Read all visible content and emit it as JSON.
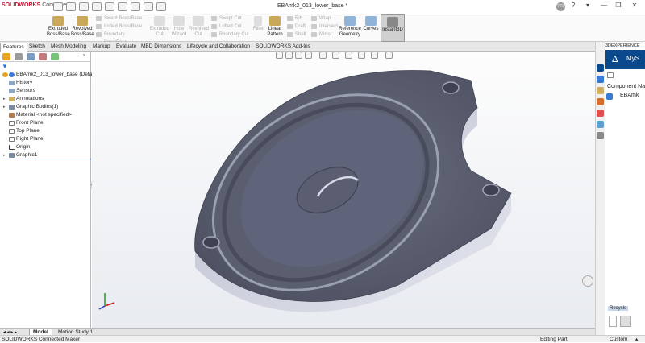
{
  "title_bar": {
    "brand": "SOLIDWORKS",
    "brand_suffix": "Connected",
    "document_title": "EBAmk2_013_lower_base *",
    "user_initials": "FR"
  },
  "ribbon": {
    "extruded_boss": "Extruded Boss/Base",
    "revolved_boss": "Revolved Boss/Base",
    "swept_boss": "Swept Boss/Base",
    "lofted_boss": "Lofted Boss/Base",
    "boundary_boss": "Boundary Boss/Base",
    "extruded_cut": "Extruded Cut",
    "hole_wizard": "Hole Wizard",
    "revolved_cut": "Revolved Cut",
    "swept_cut": "Swept Cut",
    "lofted_cut": "Lofted Cut",
    "boundary_cut": "Boundary Cut",
    "fillet": "Fillet",
    "linear_pattern": "Linear Pattern",
    "rib": "Rib",
    "draft": "Draft",
    "shell": "Shell",
    "wrap": "Wrap",
    "intersect": "Intersect",
    "mirror": "Mirror",
    "reference_geometry": "Reference Geometry",
    "curves": "Curves",
    "instant3d": "Instant3D"
  },
  "command_tabs": [
    "Features",
    "Sketch",
    "Mesh Modeling",
    "Markup",
    "Evaluate",
    "MBD Dimensions",
    "Lifecycle and Collaboration",
    "SOLIDWORKS Add-Ins"
  ],
  "feature_tree": {
    "root": "EBAmk2_013_lower_base (Default",
    "items": [
      "History",
      "Sensors",
      "Annotations",
      "Graphic Bodies(1)",
      "Material <not specified>",
      "Front Plane",
      "Top Plane",
      "Right Plane",
      "Origin",
      "Graphic1"
    ]
  },
  "task_pane": {
    "header": "3DEXPERIENCE",
    "brand": "MyS",
    "component_label": "Component Nam",
    "component_item": "EBAmk",
    "recycle": "Recycle"
  },
  "bottom_tabs": [
    "Model",
    "Motion Study 1"
  ],
  "status": {
    "left": "SOLIDWORKS Connected Maker",
    "middle": "Editing Part",
    "right": "Custom"
  },
  "colors": {
    "brand_red": "#c8102e",
    "part_gray": "#5e6272",
    "selection_blue": "#2b7bd6",
    "task_pane_blue": "#0a4a8c"
  }
}
